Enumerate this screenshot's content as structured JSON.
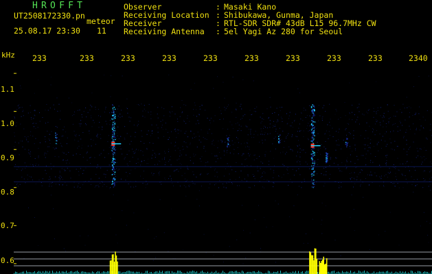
{
  "header": {
    "logo": "HROFFT",
    "file_name": "UT2508172330.pn",
    "file_suffix": "meteor",
    "date_time": "25.08.17 23:30",
    "event_count": "11"
  },
  "station": [
    {
      "label": "Observer",
      "value": "Masaki Kano"
    },
    {
      "label": "Receiving Location",
      "value": "Shibukawa, Gunma, Japan"
    },
    {
      "label": "Receiver",
      "value": "RTL-SDR SDR# 43dB L15 96.7MHz CW"
    },
    {
      "label": "Receiving Antenna",
      "value": "5el Yagi Az 280 for Seoul"
    }
  ],
  "separator": ":",
  "axes": {
    "y_unit": "kHz",
    "x_ticks": [
      "233",
      "233",
      "233",
      "233",
      "233",
      "233",
      "233",
      "233",
      "233",
      "2340"
    ],
    "y_ticks": [
      "1.1",
      "1.0",
      "0.9",
      "0.8",
      "0.7",
      "0.6"
    ]
  },
  "colors": {
    "background": "#000000",
    "text": "#f0e010",
    "logo": "#55e655",
    "noise": "#1a2ea8",
    "echo_core": "#ff3020",
    "echo_mid": "#20d0ff",
    "activity_bar": "#ffff00",
    "activity_noise": "#20d8d8"
  },
  "chart_data": {
    "type": "heatmap",
    "title": "",
    "xlabel": "",
    "ylabel": "kHz",
    "x_tick_labels": [
      "233",
      "233",
      "233",
      "233",
      "233",
      "233",
      "233",
      "233",
      "233",
      "2340"
    ],
    "y_tick_labels": [
      "1.1",
      "1.0",
      "0.9",
      "0.8",
      "0.7",
      "0.6"
    ],
    "ylim": [
      0.58,
      1.12
    ],
    "x_range_minutes": [
      0,
      10
    ],
    "detections": [
      {
        "minute": 0.45,
        "freq_khz": 0.93,
        "intensity": "faint"
      },
      {
        "minute": 1.9,
        "freq_khz": 0.915,
        "intensity": "strong",
        "span_khz": [
          0.8,
          1.02
        ]
      },
      {
        "minute": 4.8,
        "freq_khz": 0.92,
        "intensity": "faint"
      },
      {
        "minute": 6.1,
        "freq_khz": 0.925,
        "intensity": "faint"
      },
      {
        "minute": 6.95,
        "freq_khz": 0.91,
        "intensity": "strong",
        "span_khz": [
          0.8,
          1.02
        ]
      },
      {
        "minute": 7.3,
        "freq_khz": 0.88,
        "intensity": "medium"
      },
      {
        "minute": 7.8,
        "freq_khz": 0.92,
        "intensity": "faint"
      }
    ],
    "carrier_lines_khz": [
      0.815,
      0.855
    ],
    "activity_peaks": [
      {
        "minute": 1.9,
        "level": 0.9
      },
      {
        "minute": 6.95,
        "level": 1.0
      },
      {
        "minute": 7.2,
        "level": 0.7
      }
    ]
  }
}
